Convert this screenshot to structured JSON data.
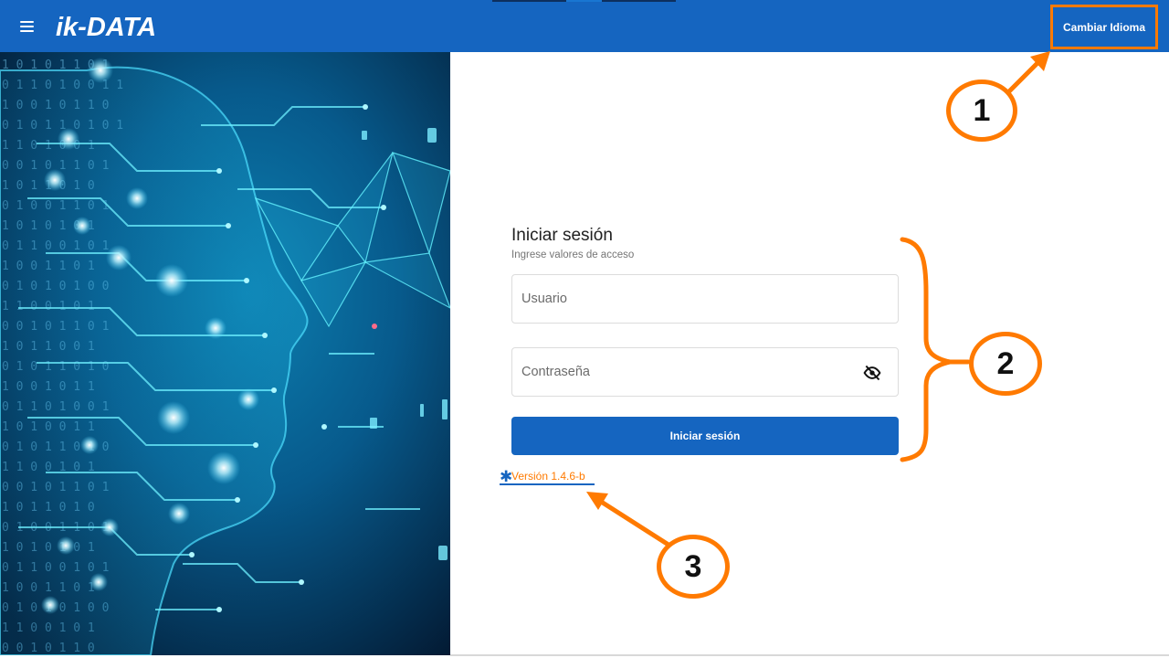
{
  "header": {
    "logo_text": "ik-DATA",
    "change_language_label": "Cambiar Idioma"
  },
  "login": {
    "title": "Iniciar sesión",
    "subtitle": "Ingrese valores de acceso",
    "username_placeholder": "Usuario",
    "password_placeholder": "Contraseña",
    "submit_label": "Iniciar sesión"
  },
  "footer": {
    "version": "Versión 1.4.6-b"
  },
  "annotations": {
    "callout_1": "1",
    "callout_2": "2",
    "callout_3": "3"
  },
  "colors": {
    "primary": "#1565c0",
    "annotation": "#ff7a00"
  },
  "icons": {
    "menu": "menu-icon",
    "password_visibility": "eye-off-icon"
  }
}
